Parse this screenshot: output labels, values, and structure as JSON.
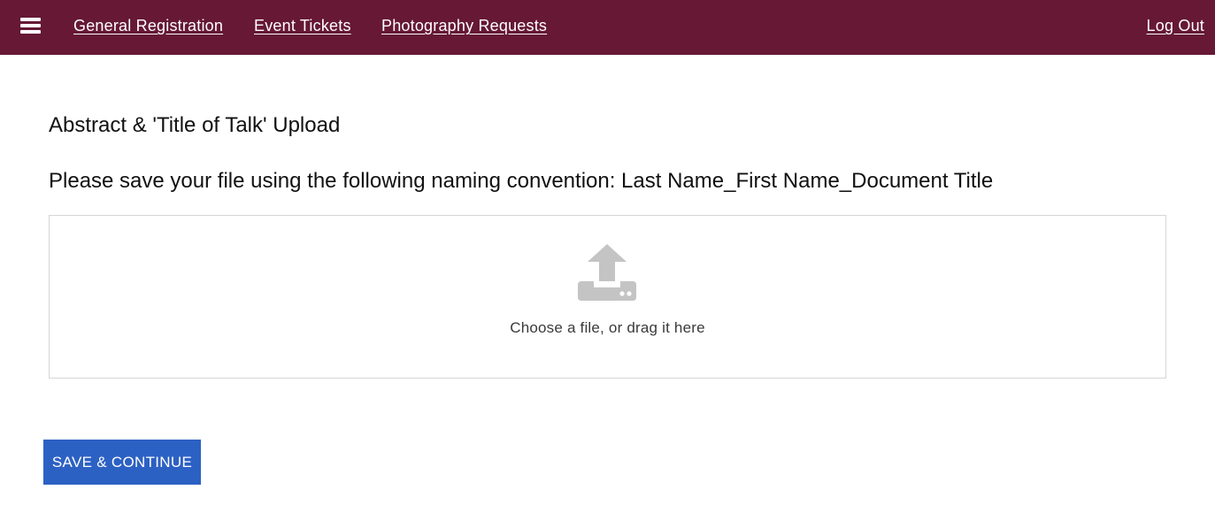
{
  "header": {
    "menu_icon": "hamburger-menu-icon",
    "nav": {
      "general_registration": "General Registration",
      "event_tickets": "Event Tickets",
      "photography_requests": "Photography Requests"
    },
    "logout_label": "Log Out",
    "background_color": "#661835"
  },
  "main": {
    "section_title": "Abstract & 'Title of Talk' Upload",
    "instruction": "Please save your file using the following naming convention: Last Name_First Name_Document Title",
    "dropzone": {
      "icon": "upload-icon",
      "text": "Choose a file, or drag it here"
    },
    "save_button_label": "SAVE & CONTINUE",
    "button_color": "#2c61c4"
  }
}
